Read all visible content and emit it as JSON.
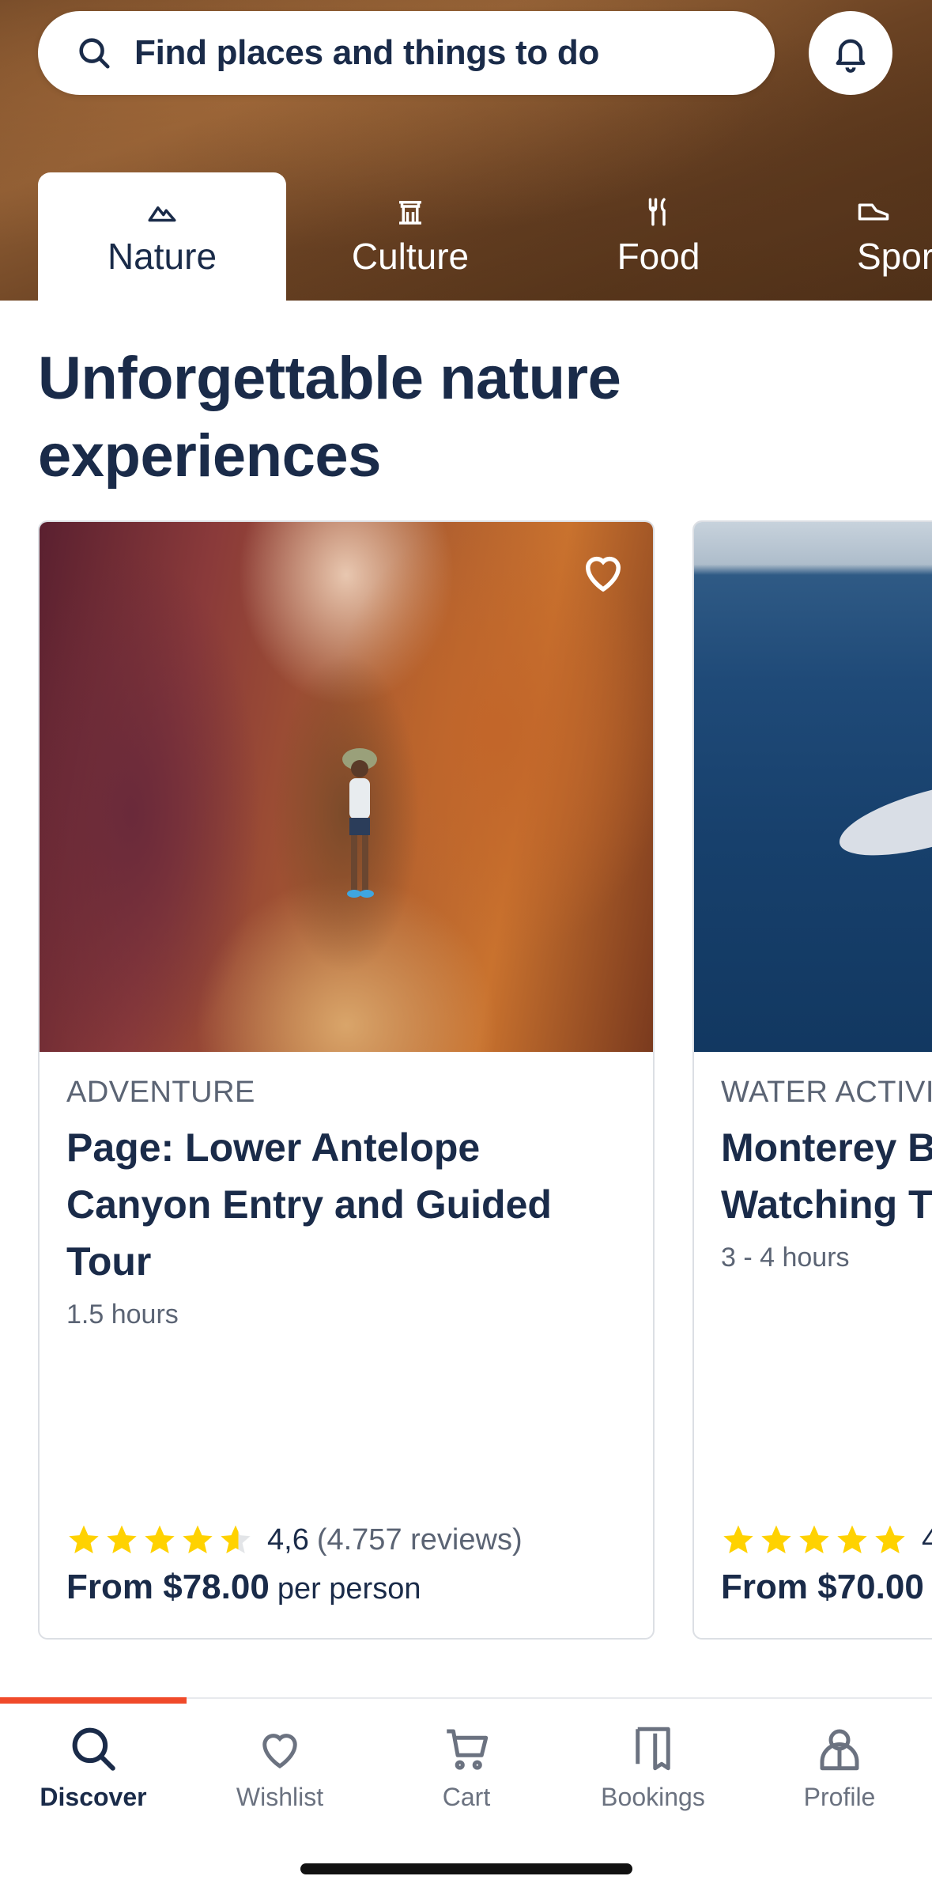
{
  "search": {
    "placeholder": "Find places and things to do"
  },
  "tabs": [
    {
      "label": "Nature",
      "icon": "mountain-icon",
      "active": true
    },
    {
      "label": "Culture",
      "icon": "temple-icon",
      "active": false
    },
    {
      "label": "Food",
      "icon": "fork-knife-icon",
      "active": false
    },
    {
      "label": "Spor",
      "icon": "shoe-icon",
      "active": false
    }
  ],
  "section": {
    "title": "Unforgettable nature experiences"
  },
  "cards": [
    {
      "category": "ADVENTURE",
      "title": "Page: Lower Antelope Canyon Entry and Guided Tour",
      "duration": "1.5 hours",
      "stars": 4.6,
      "rating": "4,6",
      "reviews": "(4.757 reviews)",
      "price": "From $78.00",
      "per": "per person"
    },
    {
      "category": "WATER ACTIVI",
      "title": "Monterey B Watching T",
      "duration": "3 - 4 hours",
      "stars": 5,
      "rating": "4",
      "price": "From $70.00"
    }
  ],
  "nav": [
    {
      "label": "Discover",
      "icon": "search-icon",
      "active": true
    },
    {
      "label": "Wishlist",
      "icon": "heart-icon",
      "active": false
    },
    {
      "label": "Cart",
      "icon": "cart-icon",
      "active": false
    },
    {
      "label": "Bookings",
      "icon": "bookmark-map-icon",
      "active": false
    },
    {
      "label": "Profile",
      "icon": "profile-icon",
      "active": false
    }
  ],
  "colors": {
    "primary": "#1a2b49",
    "accent": "#f04a2a",
    "star": "#ffd200"
  }
}
